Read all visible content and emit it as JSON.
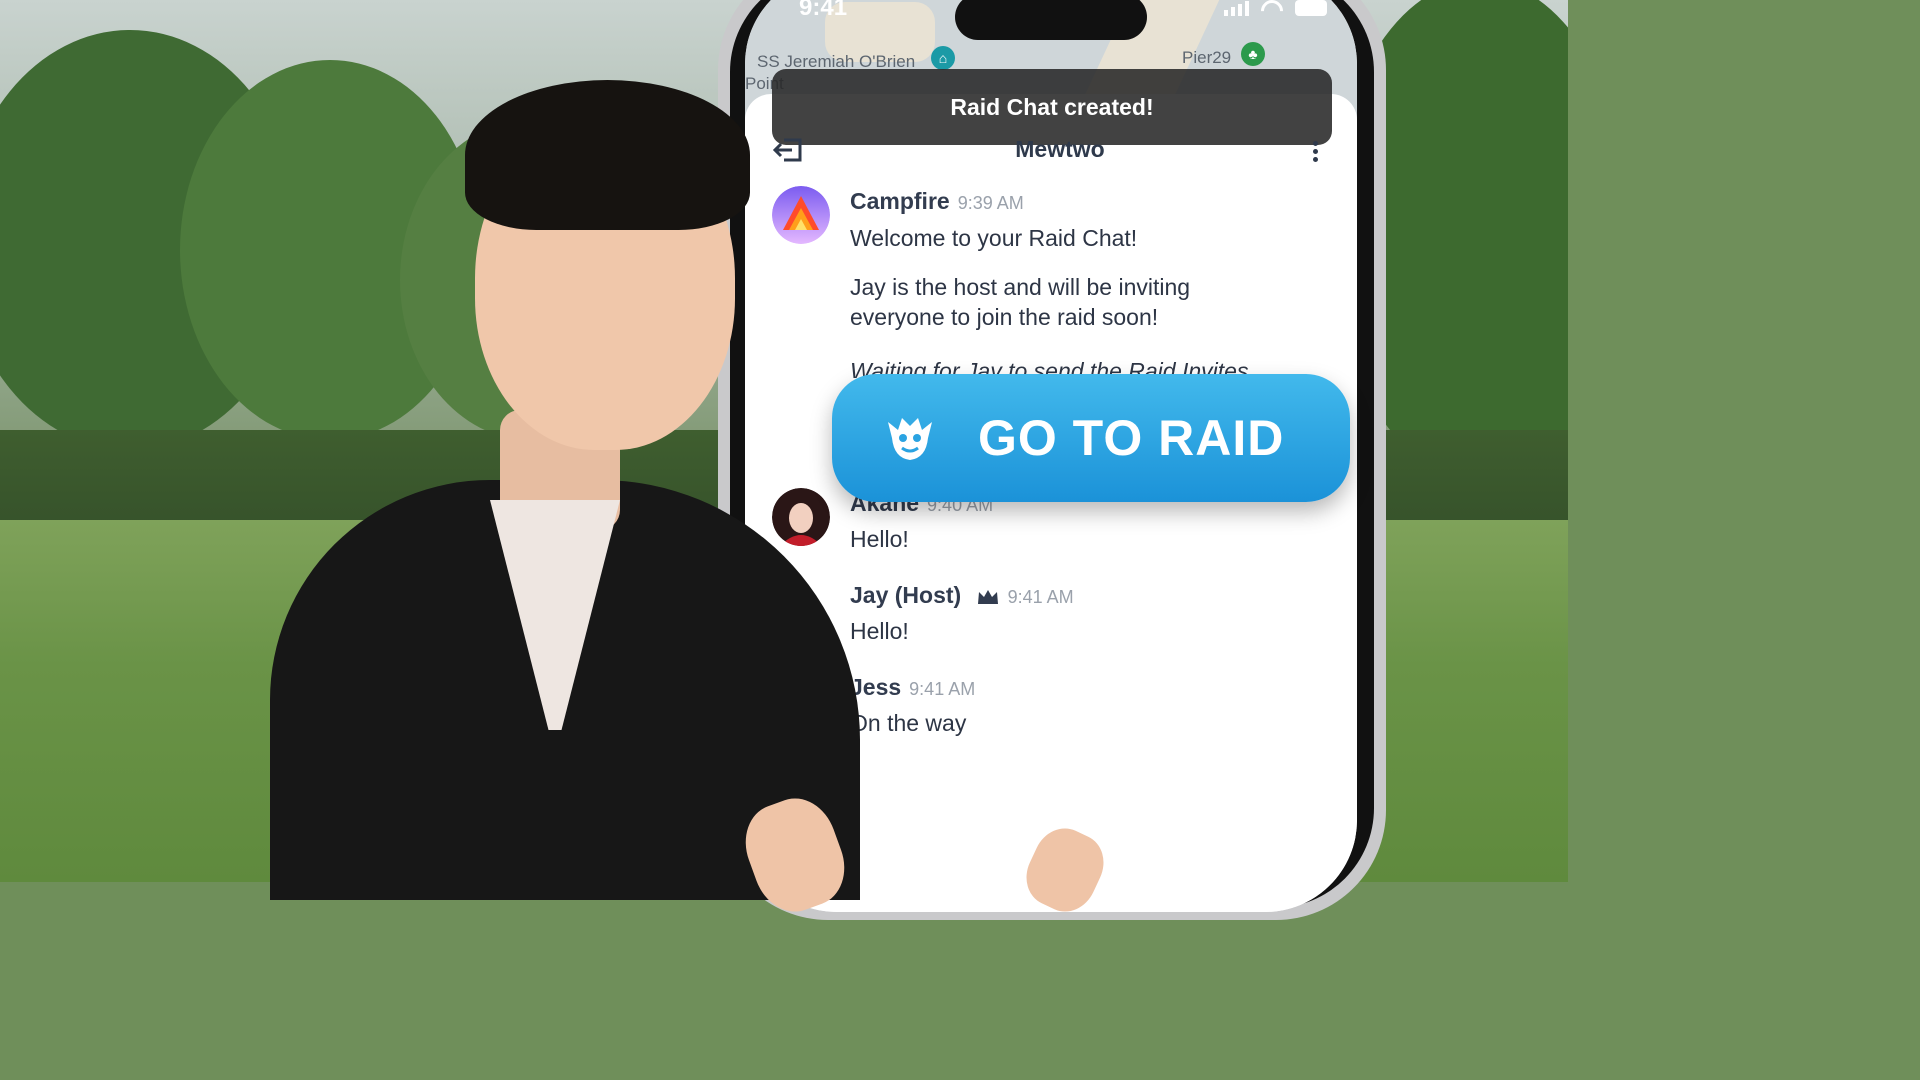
{
  "status_bar": {
    "time": "9:41"
  },
  "map": {
    "label_left": "SS Jeremiah O'Brien",
    "label_left_sub": "Point",
    "label_right": "Pier29"
  },
  "toast": {
    "text": "Raid Chat created!"
  },
  "chat": {
    "title": "Mewtwo",
    "messages": [
      {
        "name": "Campfire",
        "time": "9:39 AM",
        "lines": [
          "Welcome to your Raid Chat!",
          "Jay is the host and will be inviting everyone to join the raid soon!",
          "Waiting for Jay to send the Raid Invites..."
        ]
      },
      {
        "name": "Akane",
        "time": "9:40 AM",
        "text": "Hello!"
      },
      {
        "name": "Jay (Host)",
        "time": "9:41 AM",
        "text": "Hello!"
      },
      {
        "name": "Jess",
        "time": "9:41 AM",
        "text": "On the way"
      }
    ]
  },
  "raid_button": {
    "label": "GO TO RAID",
    "color": "#2aa3e2"
  },
  "icons": [
    "exit-icon",
    "more-icon",
    "crown-icon",
    "raid-monster-icon",
    "signal-icon",
    "wifi-icon",
    "battery-icon",
    "museum-pin-icon",
    "park-pin-icon"
  ]
}
